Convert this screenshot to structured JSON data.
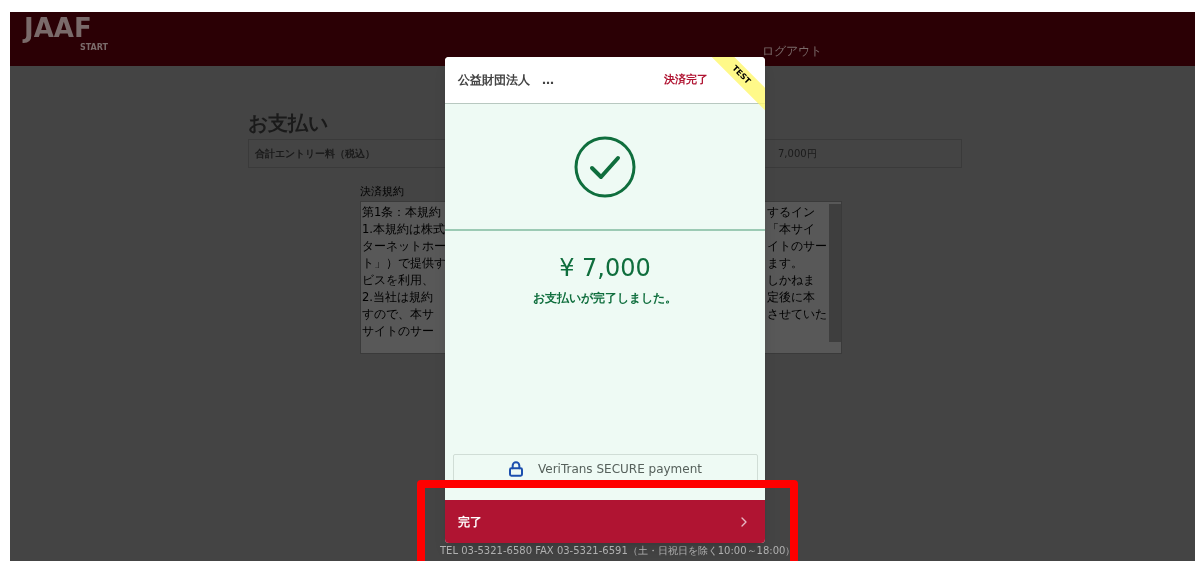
{
  "header": {
    "logo": "JAAF",
    "logo_sub": "START",
    "logout": "ログアウト"
  },
  "page": {
    "title": "お支払い",
    "total_label": "合計エントリー料（税込）",
    "total_value": "7,000円",
    "terms_label": "決済規約",
    "terms_left": [
      "第1条：本規約",
      "1.本規約は株式",
      "ターネットホー",
      "ト」）で提供す",
      "ビスを利用、",
      "2.当社は規約",
      "すので、本サ",
      "サイトのサー"
    ],
    "terms_right": [
      "するイン",
      "「本サイ",
      "イトのサー",
      "ます。",
      "しかねま",
      "定後に本",
      "させていた"
    ]
  },
  "modal": {
    "merchant": "公益財団法人",
    "more": "…",
    "status": "決済完了",
    "ribbon": "TEST",
    "amount": "¥ 7,000",
    "message": "お支払いが完了しました。",
    "secure_label": "VeriTrans SECURE payment",
    "button": "完了"
  },
  "footer": {
    "contact": "TEL 03-5321-6580 FAX 03-5321-6591（土・日祝日を除く10:00～18:00）"
  }
}
